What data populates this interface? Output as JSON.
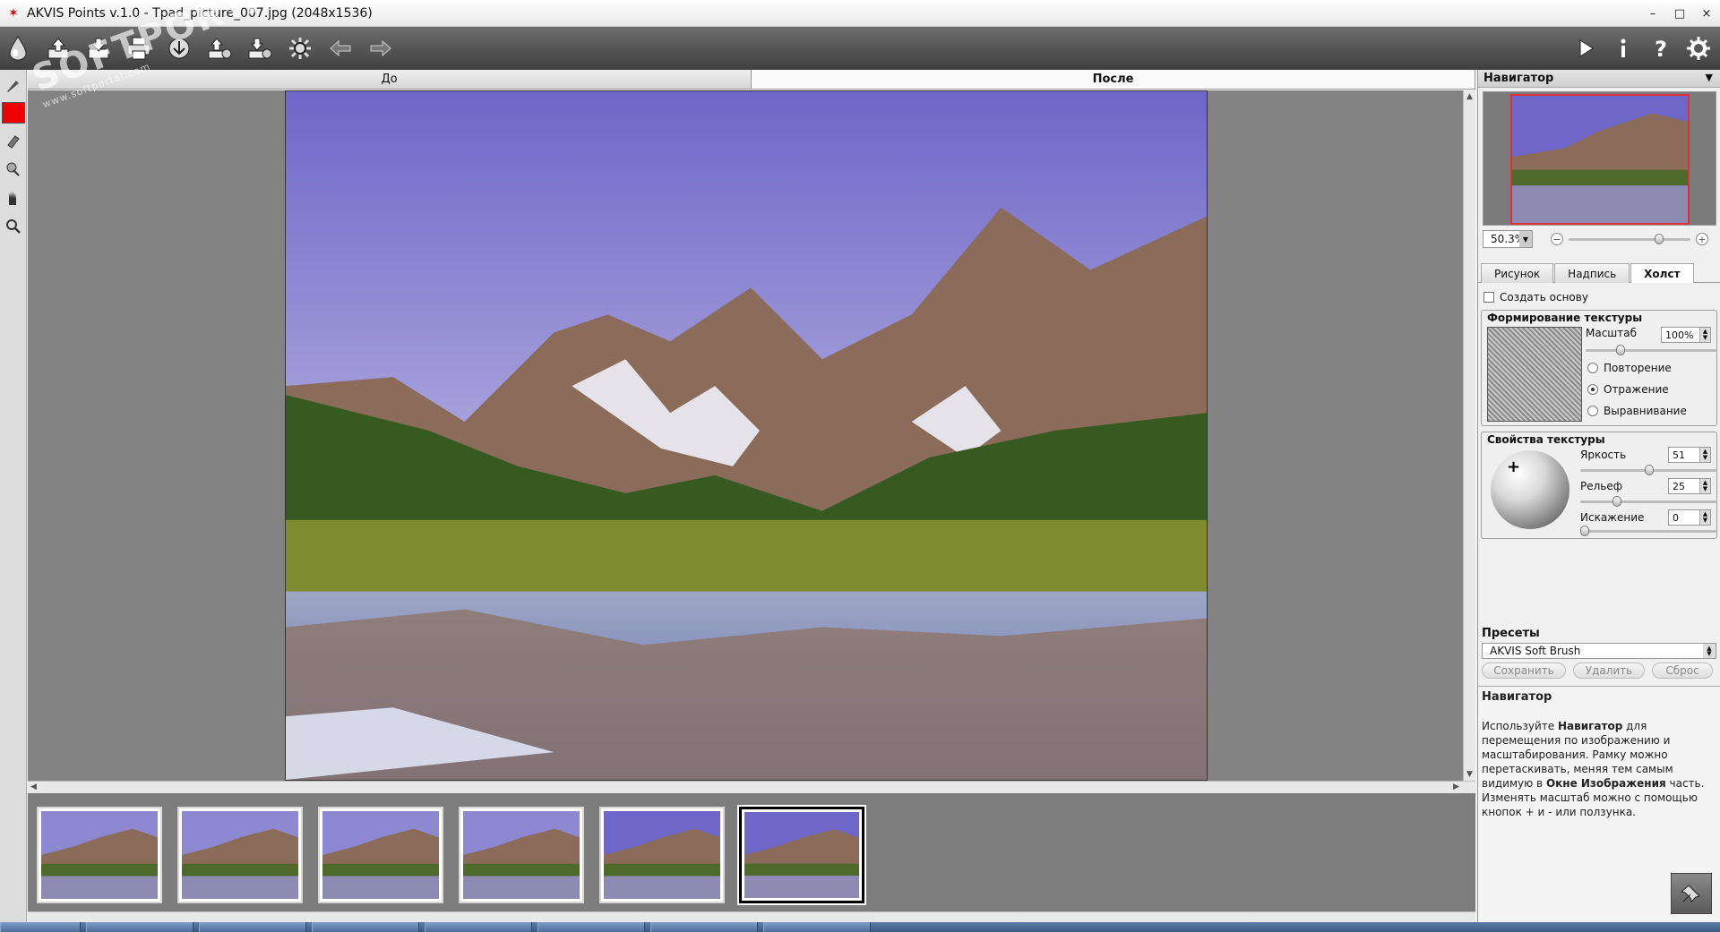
{
  "window": {
    "title": "AKVIS Points v.1.0 - Tpad_picture_007.jpg (2048x1536)",
    "controls": [
      "–",
      "□",
      "×"
    ]
  },
  "watermark": {
    "text": "SOFTPORTAL",
    "sub": "www.softportal.com"
  },
  "toolbar": {
    "left_icons": [
      "akvis-logo-icon",
      "open-icon",
      "save-icon",
      "print-icon",
      "share-icon",
      "load-preset-icon",
      "save-preset-icon",
      "settings-batch-icon",
      "undo-icon",
      "redo-icon"
    ],
    "right_icons": [
      "run-icon",
      "info-icon",
      "help-icon",
      "preferences-icon"
    ]
  },
  "left_tools": [
    "brush-icon",
    "color-swatch",
    "eraser-icon",
    "stamp-icon",
    "hand-icon",
    "zoom-icon"
  ],
  "view_tabs": {
    "before": "До",
    "after": "После",
    "active": "after"
  },
  "navigator": {
    "title": "Навигатор",
    "zoom": "50.3%",
    "zoom_level": 0.76
  },
  "panel_tabs": {
    "items": [
      "Рисунок",
      "Надпись",
      "Холст"
    ],
    "active": "Холст"
  },
  "canvas_settings": {
    "create_base_label": "Создать основу",
    "create_base_checked": false,
    "texture_forming": {
      "title": "Формирование текстуры",
      "scale_label": "Масштаб",
      "scale_value": "100%",
      "scale_level": 0.25,
      "options": [
        "Повторение",
        "Отражение",
        "Выравнивание"
      ],
      "selected_option": "Отражение"
    },
    "texture_props": {
      "title": "Свойства текстуры",
      "brightness_label": "Яркость",
      "brightness_value": "51",
      "brightness_level": 0.51,
      "relief_label": "Рельеф",
      "relief_value": "25",
      "relief_level": 0.25,
      "distortion_label": "Искажение",
      "distortion_value": "0",
      "distortion_level": 0
    }
  },
  "presets": {
    "title": "Пресеты",
    "selected": "AKVIS Soft Brush",
    "save_label": "Сохранить",
    "delete_label": "Удалить",
    "reset_label": "Сброс"
  },
  "help": {
    "title": "Навигатор",
    "p1": "Используйте ",
    "b1": "Навигатор",
    "p2": " для перемещения по изображению и масштабирования. Рамку можно перетаскивать, меняя тем самым видимую в ",
    "b2": "Окне Изображения",
    "p3": " часть. Изменять масштаб можно с помощью кнопок + и - или ползунка."
  },
  "thumbnails": {
    "count": 6,
    "selected": 5
  },
  "colors": {
    "toolbar_top": "#6d6d6d",
    "toolbar_bottom": "#3f3f3f",
    "canvas_bg": "#838383",
    "foreground_color": "#ee0000",
    "navigator_frame": "#e0303a"
  }
}
